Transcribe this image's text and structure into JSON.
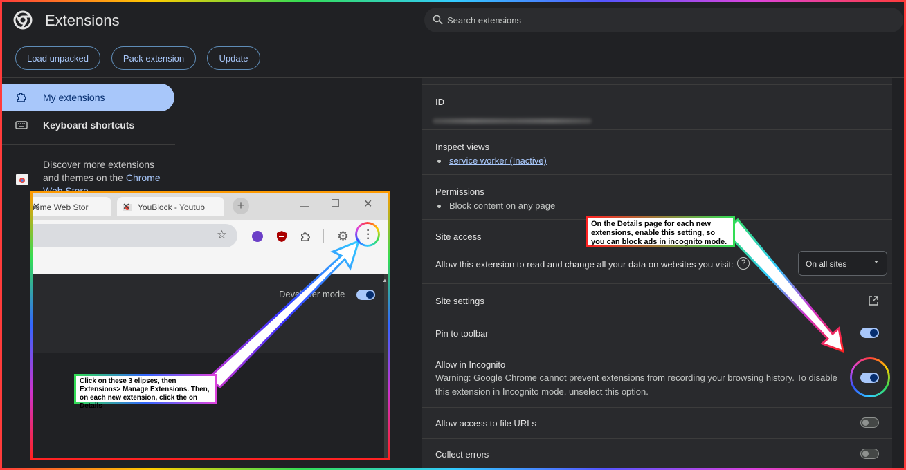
{
  "header": {
    "title": "Extensions",
    "search_placeholder": "Search extensions"
  },
  "toolbar": {
    "load_unpacked": "Load unpacked",
    "pack_extension": "Pack extension",
    "update": "Update"
  },
  "sidebar": {
    "items": [
      {
        "label": "My extensions",
        "icon": "extension-puzzle-icon"
      },
      {
        "label": "Keyboard shortcuts",
        "icon": "keyboard-icon"
      }
    ],
    "discover_text": "Discover more extensions and themes on the ",
    "discover_link": "Chrome Web Store"
  },
  "details": {
    "id_label": "ID",
    "inspect_label": "Inspect views",
    "inspect_link": "service worker (Inactive)",
    "permissions_label": "Permissions",
    "permission_item": "Block content on any page",
    "site_access_label": "Site access",
    "site_access_desc": "Allow this extension to read and change all your data on websites you visit:",
    "site_access_value": "On all sites",
    "site_settings_label": "Site settings",
    "pin_label": "Pin to toolbar",
    "incognito_label": "Allow in Incognito",
    "incognito_warning": "Warning: Google Chrome cannot prevent extensions from recording your browsing history. To disable this extension in Incognito mode, unselect this option.",
    "file_urls_label": "Allow access to file URLs",
    "collect_errors_label": "Collect errors",
    "toggles": {
      "pin": true,
      "incognito": true,
      "file_urls": false,
      "collect_errors": false
    }
  },
  "inset": {
    "tab1": "rome Web Stor",
    "tab2": "YouBlock - Youtub",
    "dev_mode_label": "Developer mode",
    "dev_mode": true
  },
  "callouts": {
    "left": "Click on these 3 elipses, then Extensions> Manage Extensions. Then, on each new extension, click the on Details",
    "right": "On the Details page for each new extensions, enable this setting, so you can block ads in incognito mode."
  },
  "colors": {
    "accent": "#a8c7fa",
    "background": "#202124",
    "panel": "#292a2d"
  }
}
